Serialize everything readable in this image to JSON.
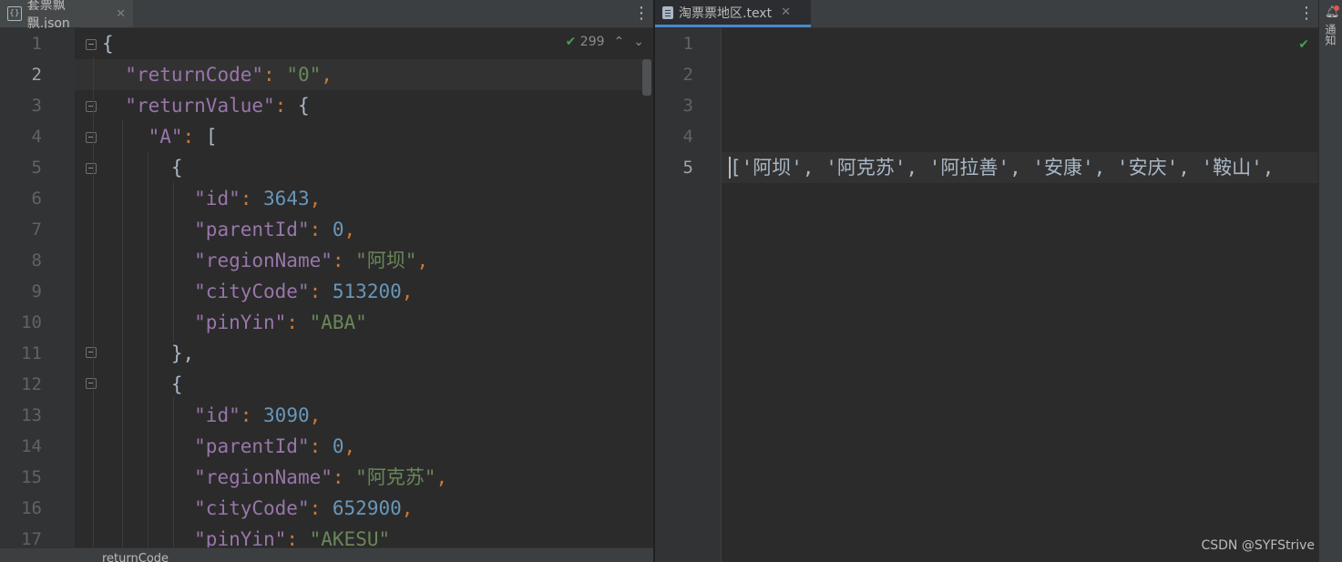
{
  "left_editor": {
    "tab": {
      "label": "套票飘飘.json",
      "icon": "json-file-icon",
      "close": "✕"
    },
    "inspection_count": "299",
    "line_numbers": [
      "1",
      "2",
      "3",
      "4",
      "5",
      "6",
      "7",
      "8",
      "9",
      "10",
      "11",
      "12",
      "13",
      "14",
      "15",
      "16",
      "17"
    ],
    "current_line": "2",
    "breadcrumb": "returnCode",
    "code": {
      "l1": "{",
      "l2_key": "\"returnCode\"",
      "l2_val": "\"0\"",
      "l3_key": "\"returnValue\"",
      "l3_rest": "{",
      "l4_key": "\"A\"",
      "l4_rest": "[",
      "l5": "{",
      "l6_key": "\"id\"",
      "l6_val": "3643",
      "l7_key": "\"parentId\"",
      "l7_val": "0",
      "l8_key": "\"regionName\"",
      "l8_val": "\"阿坝\"",
      "l9_key": "\"cityCode\"",
      "l9_val": "513200",
      "l10_key": "\"pinYin\"",
      "l10_val": "\"ABA\"",
      "l11": "},",
      "l12": "{",
      "l13_key": "\"id\"",
      "l13_val": "3090",
      "l14_key": "\"parentId\"",
      "l14_val": "0",
      "l15_key": "\"regionName\"",
      "l15_val": "\"阿克苏\"",
      "l16_key": "\"cityCode\"",
      "l16_val": "652900",
      "l17_key": "\"pinYin\"",
      "l17_val_open": "\"",
      "l17_val_word": "AKESU",
      "l17_val_close": "\""
    }
  },
  "right_editor": {
    "tab": {
      "label": "淘票票地区.text",
      "icon": "text-file-icon",
      "close": "✕"
    },
    "line_numbers": [
      "1",
      "2",
      "3",
      "4",
      "5"
    ],
    "line5": "['阿坝', '阿克苏', '阿拉善', '安康', '安庆', '鞍山',"
  },
  "side_strip": {
    "label": "通知"
  },
  "watermark": "CSDN @SYFStrive",
  "colors": {
    "keyword": "#9876aa",
    "string": "#6a8759",
    "number": "#6897bb",
    "punct": "#cc7832",
    "accent": "#4a88c7"
  }
}
